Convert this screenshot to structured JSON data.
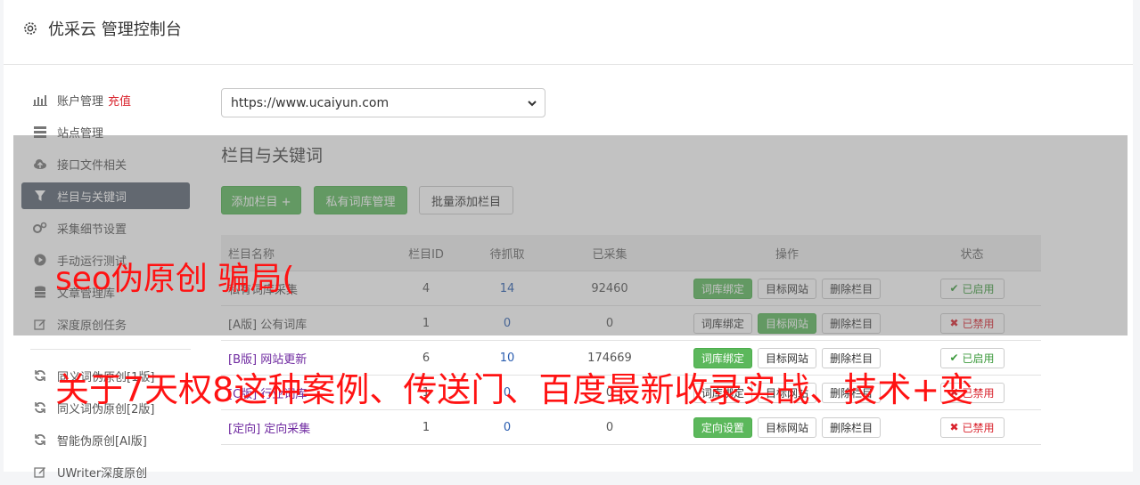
{
  "header": {
    "title": "优采云 管理控制台"
  },
  "sidebar": {
    "items": [
      {
        "label": "账户管理",
        "extra": "充值",
        "icon": "bar-chart-icon"
      },
      {
        "label": "站点管理",
        "icon": "server-icon"
      },
      {
        "label": "接口文件相关",
        "icon": "cloud-upload-icon"
      },
      {
        "label": "栏目与关键词",
        "icon": "filter-icon",
        "active": true
      },
      {
        "label": "采集细节设置",
        "icon": "cogs-icon"
      },
      {
        "label": "手动运行测试",
        "icon": "play-circle-icon"
      },
      {
        "label": "文章管理库",
        "icon": "database-icon"
      },
      {
        "label": "深度原创任务",
        "icon": "edit-icon"
      },
      {
        "label": "同义词伪原创[1版]",
        "icon": "refresh-icon"
      },
      {
        "label": "同义词伪原创[2版]",
        "icon": "refresh-icon"
      },
      {
        "label": "智能伪原创[AI版]",
        "icon": "refresh-icon"
      },
      {
        "label": "UWriter深度原创",
        "icon": "edit-icon"
      }
    ]
  },
  "site_select": {
    "value": "https://www.ucaiyun.com"
  },
  "main": {
    "title": "栏目与关键词",
    "buttons": {
      "add": "添加栏目 +",
      "private_lib": "私有词库管理",
      "batch_add": "批量添加栏目"
    }
  },
  "table": {
    "headers": {
      "name": "栏目名称",
      "id": "栏目ID",
      "pending": "待抓取",
      "collected": "已采集",
      "ops": "操作",
      "status": "状态"
    },
    "rows": [
      {
        "tag": "",
        "name": "私有词库采集",
        "id": "4",
        "pending": "14",
        "collected": "92460",
        "op1": "词库绑定",
        "op2": "目标网站",
        "op3": "删除栏目",
        "status": "已启用"
      },
      {
        "tag": "[A版]",
        "name": "公有词库",
        "id": "1",
        "pending": "0",
        "collected": "0",
        "op1": "词库绑定",
        "op2": "目标网站",
        "op3": "删除栏目",
        "status": "已禁用"
      },
      {
        "tag": "[B版]",
        "name": "网站更新",
        "id": "6",
        "pending": "10",
        "collected": "174669",
        "op1": "词库绑定",
        "op2": "目标网站",
        "op3": "删除栏目",
        "status": "已启用"
      },
      {
        "tag": "[C版]",
        "name": "行业词库",
        "id": "1",
        "pending": "0",
        "collected": "0",
        "op1": "词库绑定",
        "op2": "目标网站",
        "op3": "删除栏目",
        "status": "已禁用"
      },
      {
        "tag": "[定向]",
        "name": "定向采集",
        "id": "1",
        "pending": "0",
        "collected": "0",
        "op1": "定向设置",
        "op2": "目标网站",
        "op3": "删除栏目",
        "status": "已禁用"
      }
    ]
  },
  "watermark": {
    "line1": "seo伪原创 骗局(",
    "line2": "关于7天权8这种案例、传送门、百度最新收录实战、技术+变"
  },
  "colors": {
    "accent_green": "#5cb85c",
    "active_sidebar": "#5b6572",
    "danger": "#d9232d"
  }
}
